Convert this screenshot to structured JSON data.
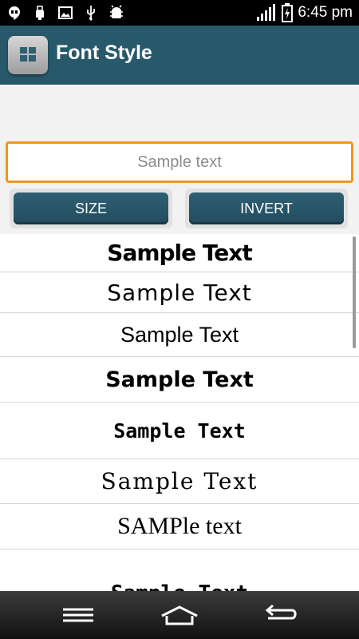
{
  "status_bar": {
    "time": "6:45 pm",
    "icons": [
      "hangouts-icon",
      "usb-icon",
      "image-icon",
      "usb-debug-icon",
      "android-debug-icon",
      "signal-icon",
      "battery-charging-icon"
    ]
  },
  "app_bar": {
    "title": "Font Style"
  },
  "input": {
    "placeholder": "Sample text",
    "value": ""
  },
  "buttons": {
    "size_label": "SIZE",
    "invert_label": "INVERT"
  },
  "list": {
    "items": [
      {
        "text": "Sample Text"
      },
      {
        "text": "Sample Text"
      },
      {
        "text": "Sample Text"
      },
      {
        "text": "Sample Text"
      },
      {
        "text": "Sample Text"
      },
      {
        "text": "Sample Text"
      },
      {
        "text": "SAMPle text"
      },
      {
        "text": "Sample Text"
      }
    ]
  },
  "nav_bar": {
    "icons": [
      "menu-icon",
      "home-icon",
      "back-icon"
    ]
  },
  "colors": {
    "app_bar": "#27596b",
    "input_border": "#f1951e",
    "button": "#2a5668"
  }
}
